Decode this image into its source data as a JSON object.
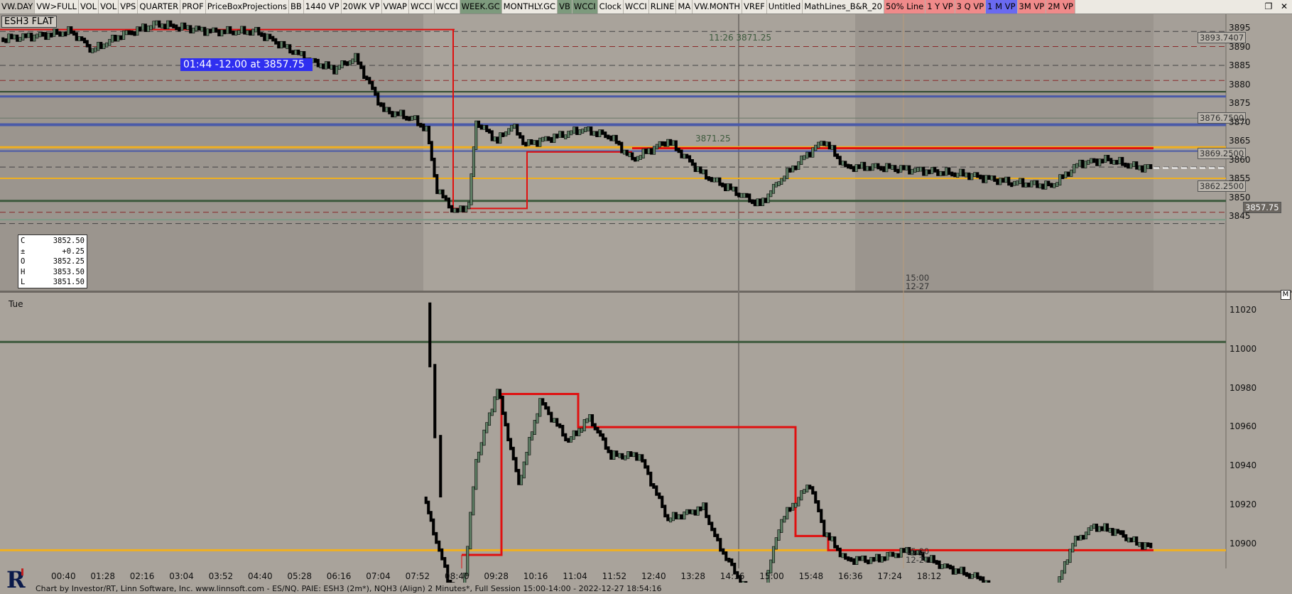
{
  "toolbar": {
    "buttons": [
      {
        "label": "VW.DAY",
        "bg": "#c8c4bc"
      },
      {
        "label": "VW>FULL",
        "bg": "#ece9e2"
      },
      {
        "label": "VOL",
        "bg": "#ece9e2"
      },
      {
        "label": "VOL",
        "bg": "#ece9e2"
      },
      {
        "label": "VPS",
        "bg": "#ece9e2"
      },
      {
        "label": "QUARTER",
        "bg": "#ece9e2"
      },
      {
        "label": "PROF",
        "bg": "#ece9e2"
      },
      {
        "label": "PriceBoxProjections",
        "bg": "#ece9e2"
      },
      {
        "label": "BB",
        "bg": "#ece9e2"
      },
      {
        "label": "1440 VP",
        "bg": "#ece9e2"
      },
      {
        "label": "20WK VP",
        "bg": "#ece9e2"
      },
      {
        "label": "VWAP",
        "bg": "#ece9e2"
      },
      {
        "label": "WCCI",
        "bg": "#ece9e2"
      },
      {
        "label": "WCCI",
        "bg": "#ece9e2"
      },
      {
        "label": "WEEK.GC",
        "bg": "#7d9a7d"
      },
      {
        "label": "MONTHLY.GC",
        "bg": "#ece9e2"
      },
      {
        "label": "VB",
        "bg": "#7d9a7d"
      },
      {
        "label": "WCCI",
        "bg": "#7d9a7d"
      },
      {
        "label": "Clock",
        "bg": "#ece9e2"
      },
      {
        "label": "WCCI",
        "bg": "#ece9e2"
      },
      {
        "label": "RLINE",
        "bg": "#ece9e2"
      },
      {
        "label": "MA",
        "bg": "#ece9e2"
      },
      {
        "label": "VW.MONTH",
        "bg": "#ece9e2"
      },
      {
        "label": "VREF",
        "bg": "#ece9e2"
      },
      {
        "label": "Untitled",
        "bg": "#ece9e2"
      },
      {
        "label": "MathLines_B&R_20",
        "bg": "#ece9e2"
      },
      {
        "label": "50% Line",
        "bg": "#f08a8a"
      },
      {
        "label": "1 Y VP",
        "bg": "#f08a8a"
      },
      {
        "label": "3 Q VP",
        "bg": "#f08a8a"
      },
      {
        "label": "1 M VP",
        "bg": "#6a6af0"
      },
      {
        "label": "3M VP",
        "bg": "#f08a8a"
      },
      {
        "label": "2M VP",
        "bg": "#f08a8a"
      }
    ],
    "window_controls": {
      "restore": "restore-icon",
      "close": "close-icon"
    }
  },
  "upper_chart": {
    "symbol_label": "ESH3 FLAT",
    "trade_tag": "01:44  -12.00 at 3857.75",
    "ohlc": [
      {
        "k": "C",
        "v": "3852.50"
      },
      {
        "k": "±",
        "v": "+0.25"
      },
      {
        "k": "O",
        "v": "3852.25"
      },
      {
        "k": "H",
        "v": "3853.50"
      },
      {
        "k": "L",
        "v": "3851.50"
      }
    ],
    "price_ticks": [
      "3895",
      "3890",
      "3885",
      "3880",
      "3875",
      "3870",
      "3865",
      "3860",
      "3855",
      "3850",
      "3845"
    ],
    "price_tags": [
      "3893.7407",
      "3876.7500",
      "3869.2500",
      "3862.2500",
      "3857.75"
    ],
    "annotations": {
      "high_note": "11:26 3871.25",
      "level_note": "3871.25",
      "session_time": "15:00",
      "session_date": "12-27"
    }
  },
  "lower_chart": {
    "day_label": "Tue",
    "price_ticks": [
      "11020",
      "11000",
      "10980",
      "10960",
      "10940",
      "10920",
      "10900"
    ],
    "pane_button": "M",
    "annotations": {
      "session_time": "15:00",
      "session_date": "12-27"
    }
  },
  "time_axis": [
    "00:40",
    "01:28",
    "02:16",
    "03:04",
    "03:52",
    "04:40",
    "05:28",
    "06:16",
    "07:04",
    "07:52",
    "08:40",
    "09:28",
    "10:16",
    "11:04",
    "11:52",
    "12:40",
    "13:28",
    "14:16",
    "15:00",
    "15:48",
    "16:36",
    "17:24",
    "18:12"
  ],
  "status_bar": {
    "text": "Chart by Investor/RT, Linn Software, Inc. www.linnsoft.com - ES/NQ. PAIE: ESH3 (2m*), NQH3 (Align) 2 Minutes*, Full Session 15:00-14:00 - 2022-12-27 18:54:16",
    "logo": "investor-rt-logo"
  },
  "colors": {
    "bg": "#a9a39b",
    "session_shade": "#9b958e",
    "candle_up": "#5f7f65",
    "candle_down": "#000000",
    "red": "#e01010",
    "orange": "#f0b020",
    "blue": "#4a5aa8",
    "green": "#3d5a3d"
  }
}
